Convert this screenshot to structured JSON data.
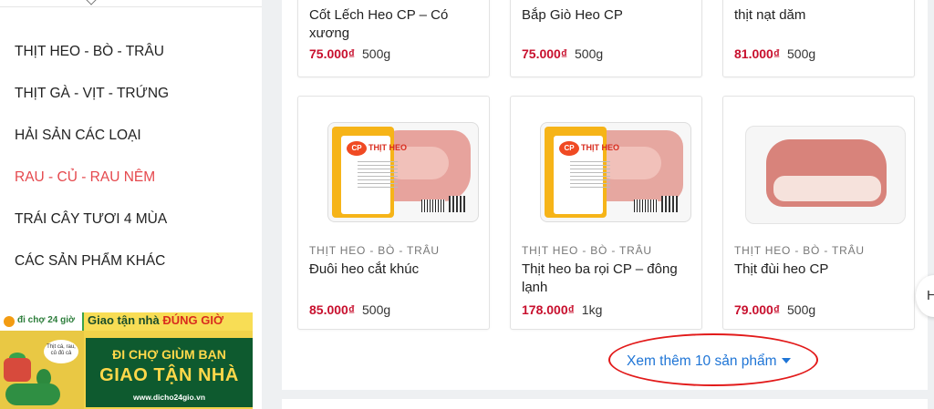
{
  "sidebar": {
    "categories": [
      {
        "label": "THỊT HEO - BÒ - TRÂU"
      },
      {
        "label": "THỊT GÀ - VỊT - TRỨNG"
      },
      {
        "label": "HẢI SẢN CÁC LOẠI"
      },
      {
        "label": "RAU - CỦ - RAU NÊM",
        "active": true
      },
      {
        "label": "TRÁI CÂY TƯƠI 4 MÙA"
      },
      {
        "label": "CÁC SẢN PHẨM KHÁC"
      }
    ],
    "banner": {
      "brand": "đi chợ 24 giờ",
      "slogan_prefix": "Giao tận nhà",
      "slogan_highlight": "ĐÚNG GIỜ",
      "bubble_text": "Thịt cá, rau, củ đủ cả",
      "headline_1": "ĐI CHỢ GIÙM BẠN",
      "headline_2": "GIAO TẬN NHÀ",
      "website": "www.dicho24gio.vn"
    }
  },
  "products": {
    "row1": [
      {
        "name": "Cốt Lếch Heo CP – Có xương",
        "price": "75.000₫",
        "unit": "500g"
      },
      {
        "name": "Bắp Giò Heo CP",
        "price": "75.000₫",
        "unit": "500g"
      },
      {
        "name": "thịt nạt dăm",
        "price": "81.000₫",
        "unit": "500g"
      }
    ],
    "row2": [
      {
        "category": "THỊT HEO - BÒ - TRÂU",
        "name": "Đuôi heo cắt khúc",
        "price": "85.000₫",
        "unit": "500g",
        "package_label": "THỊT HEO",
        "package_brand": "CP"
      },
      {
        "category": "THỊT HEO - BÒ - TRÂU",
        "name": "Thịt heo ba rọi CP – đông lạnh",
        "price": "178.000₫",
        "unit": "1kg",
        "package_label": "THỊT HEO",
        "package_brand": "CP"
      },
      {
        "category": "THỊT HEO - BÒ - TRÂU",
        "name": "Thịt đùi heo CP",
        "price": "79.000₫",
        "unit": "500g"
      }
    ]
  },
  "load_more": {
    "label": "Xem thêm 10 sản phẩm",
    "icon": "caret-down-icon"
  },
  "scroll_button": {
    "label": "H"
  },
  "colors": {
    "price": "#c8102e",
    "active_category": "#e5484d",
    "link": "#1f75d6",
    "annotation_circle": "#e21a1a"
  }
}
